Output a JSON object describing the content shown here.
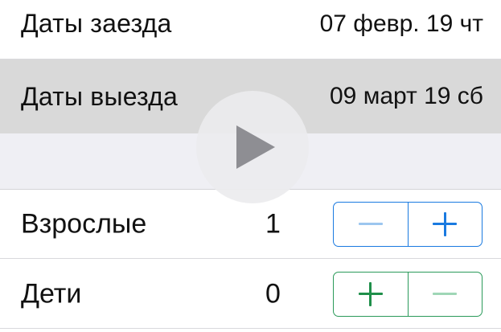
{
  "booking": {
    "checkin": {
      "label": "Даты заезда",
      "value": "07 февр. 19 чт"
    },
    "checkout": {
      "label": "Даты выезда",
      "value": "09 март 19 сб"
    }
  },
  "guests": {
    "adults": {
      "label": "Взрослые",
      "value": "1"
    },
    "children": {
      "label": "Дети",
      "value": "0"
    }
  },
  "colors": {
    "stepper_adults": "#1a7ae0",
    "stepper_children": "#2a9a5a",
    "selected_row": "#d9d9d9",
    "section_gap": "#efeff4"
  },
  "icons": {
    "play": "play-icon",
    "minus": "minus-icon",
    "plus": "plus-icon"
  }
}
